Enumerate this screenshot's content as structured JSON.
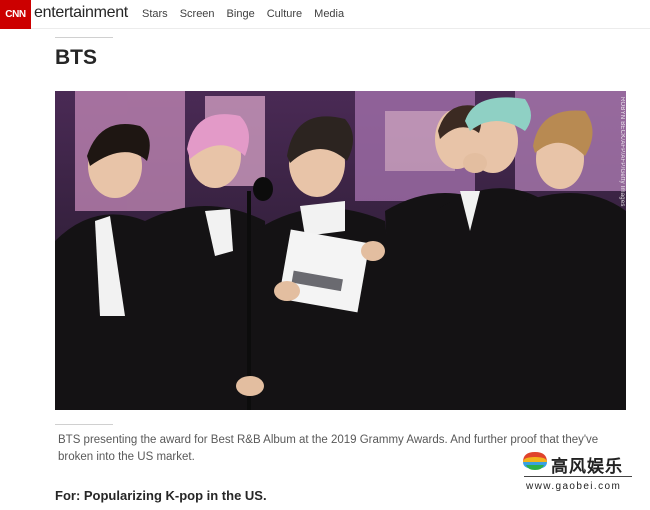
{
  "header": {
    "logo": "CNN",
    "brand": "entertainment",
    "nav": [
      "Stars",
      "Screen",
      "Binge",
      "Culture",
      "Media"
    ]
  },
  "article": {
    "title": "BTS",
    "image_credit": "ROBYN BECK/AFP/AFP/Getty Images",
    "caption": "BTS presenting the award for Best R&B Album at the 2019 Grammy Awards. And further proof that they've broken into the US market.",
    "subhead": "For: Popularizing K-pop in the US."
  },
  "watermark": {
    "text": "高风娱乐",
    "url": "www.gaobei.com"
  },
  "colors": {
    "brand_red": "#cc0000",
    "text": "#262626",
    "caption": "#595959"
  }
}
